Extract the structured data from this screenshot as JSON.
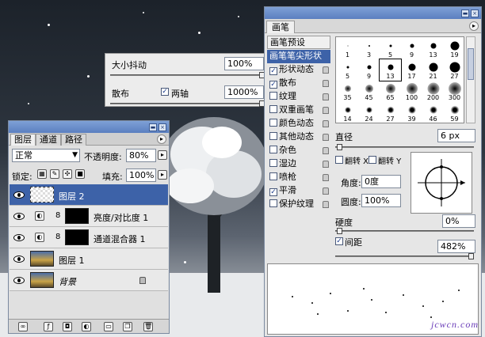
{
  "brush_panel": {
    "title": "画笔",
    "tab": "画笔",
    "list": {
      "header": "画笔预设",
      "selected": "画笔笔尖形状",
      "items": [
        {
          "label": "形状动态",
          "checked": true
        },
        {
          "label": "散布",
          "checked": true
        },
        {
          "label": "纹理",
          "checked": false
        },
        {
          "label": "双重画笔",
          "checked": false
        },
        {
          "label": "颜色动态",
          "checked": false
        },
        {
          "label": "其他动态",
          "checked": false
        },
        {
          "label": "杂色",
          "checked": false
        },
        {
          "label": "湿边",
          "checked": false
        },
        {
          "label": "喷枪",
          "checked": false
        },
        {
          "label": "平滑",
          "checked": true
        },
        {
          "label": "保护纹理",
          "checked": false
        }
      ]
    },
    "tips": [
      "1",
      "3",
      "5",
      "9",
      "13",
      "19",
      "5",
      "9",
      "13",
      "17",
      "21",
      "27",
      "35",
      "45",
      "65",
      "100",
      "200",
      "300",
      "14",
      "24",
      "27",
      "39",
      "46",
      "59"
    ],
    "selected_tip_index": 8,
    "diameter_label": "直径",
    "diameter_value": "6 px",
    "flip_x_label": "翻转 X",
    "flip_y_label": "翻转 Y",
    "angle_label": "角度:",
    "angle_value": "0度",
    "roundness_label": "圆度:",
    "roundness_value": "100%",
    "hardness_label": "硬度",
    "hardness_value": "0%",
    "spacing_label": "间距",
    "spacing_checked": true,
    "spacing_value": "482%"
  },
  "scatter_options": {
    "size_jitter_label": "大小抖动",
    "size_jitter_value": "100%",
    "scatter_label": "散布",
    "both_axes_label": "两轴",
    "both_axes_checked": true,
    "scatter_value": "1000%"
  },
  "layers_panel": {
    "tabs": [
      "图层",
      "通道",
      "路径"
    ],
    "blend_mode": "正常",
    "opacity_label": "不透明度:",
    "opacity_value": "80%",
    "lock_label": "锁定:",
    "fill_label": "填充:",
    "fill_value": "100%",
    "layers": [
      {
        "name": "图层 2",
        "selected": true
      },
      {
        "name": "亮度/对比度 1",
        "selected": false
      },
      {
        "name": "通道混合器 1",
        "selected": false
      },
      {
        "name": "图层 1",
        "selected": false
      },
      {
        "name": "背景",
        "selected": false
      }
    ]
  },
  "watermark": "jcwcn.com"
}
